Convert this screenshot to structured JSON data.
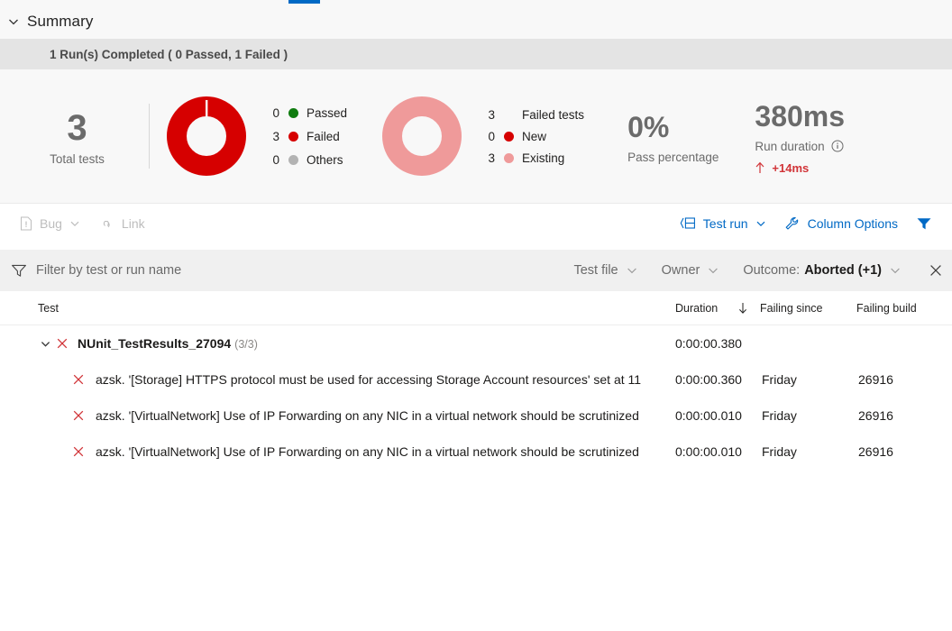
{
  "tab_indicator": {
    "color": "#0069c5"
  },
  "summary": {
    "title": "Summary",
    "chevron_icon": "chevron-down-icon",
    "run_status": "1 Run(s) Completed ( 0 Passed, 1 Failed )"
  },
  "stats": {
    "total": {
      "value": "3",
      "label": "Total tests"
    },
    "outcome_donut": {
      "legend": [
        {
          "count": "0",
          "label": "Passed",
          "color": "#107c10"
        },
        {
          "count": "3",
          "label": "Failed",
          "color": "#d60000"
        },
        {
          "count": "0",
          "label": "Others",
          "color": "#b3b3b3"
        }
      ]
    },
    "failure_donut": {
      "legend": [
        {
          "count": "3",
          "label": "Failed tests",
          "color": ""
        },
        {
          "count": "0",
          "label": "New",
          "color": "#d60000"
        },
        {
          "count": "3",
          "label": "Existing",
          "color": "#ef9a9a"
        }
      ]
    },
    "pass_percentage": {
      "value": "0%",
      "label": "Pass percentage"
    },
    "run_duration": {
      "value": "380ms",
      "label": "Run duration",
      "info_icon": "info-circle-icon",
      "delta": "+14ms",
      "delta_arrow_icon": "arrow-up-icon",
      "delta_color": "#d13438"
    }
  },
  "command_bar": {
    "left": [
      {
        "label": "Bug",
        "icon": "bug-file-icon",
        "caret": true,
        "disabled": true
      },
      {
        "label": "Link",
        "icon": "link-icon",
        "caret": false,
        "disabled": true
      }
    ],
    "right": [
      {
        "label": "Test run",
        "icon": "test-run-icon",
        "caret": true
      },
      {
        "label": "Column Options",
        "icon": "wrench-icon",
        "caret": false
      }
    ],
    "filter_toggle_icon": "filter-funnel-icon"
  },
  "filter_bar": {
    "funnel_icon": "filter-funnel-icon",
    "search_placeholder": "Filter by test or run name",
    "search_value": "",
    "dropdowns": [
      {
        "label": "Test file",
        "value": ""
      },
      {
        "label": "Owner",
        "value": ""
      },
      {
        "label": "Outcome:",
        "value": "Aborted (+1)"
      }
    ],
    "close_icon": "close-icon"
  },
  "table": {
    "columns": [
      "Test",
      "Duration",
      "Failing since",
      "Failing build"
    ],
    "sort_icon": "sort-descending-arrow-icon",
    "rows": [
      {
        "type": "group",
        "expander_icon": "chevron-down-icon",
        "status_icon": "failed-x-icon",
        "name": "NUnit_TestResults_27094",
        "count": "(3/3)",
        "duration": "0:00:00.380",
        "failing_since": "",
        "failing_build": ""
      },
      {
        "type": "test",
        "status_icon": "failed-x-icon",
        "name": "azsk. '[Storage] HTTPS protocol must be used for accessing Storage Account resources' set at 11",
        "count": "",
        "duration": "0:00:00.360",
        "failing_since": "Friday",
        "failing_build": "26916"
      },
      {
        "type": "test",
        "status_icon": "failed-x-icon",
        "name": "azsk. '[VirtualNetwork] Use of IP Forwarding on any NIC in a virtual network should be scrutinized",
        "count": "",
        "duration": "0:00:00.010",
        "failing_since": "Friday",
        "failing_build": "26916"
      },
      {
        "type": "test",
        "status_icon": "failed-x-icon",
        "name": "azsk. '[VirtualNetwork] Use of IP Forwarding on any NIC in a virtual network should be scrutinized",
        "count": "",
        "duration": "0:00:00.010",
        "failing_since": "Friday",
        "failing_build": "26916"
      }
    ]
  }
}
